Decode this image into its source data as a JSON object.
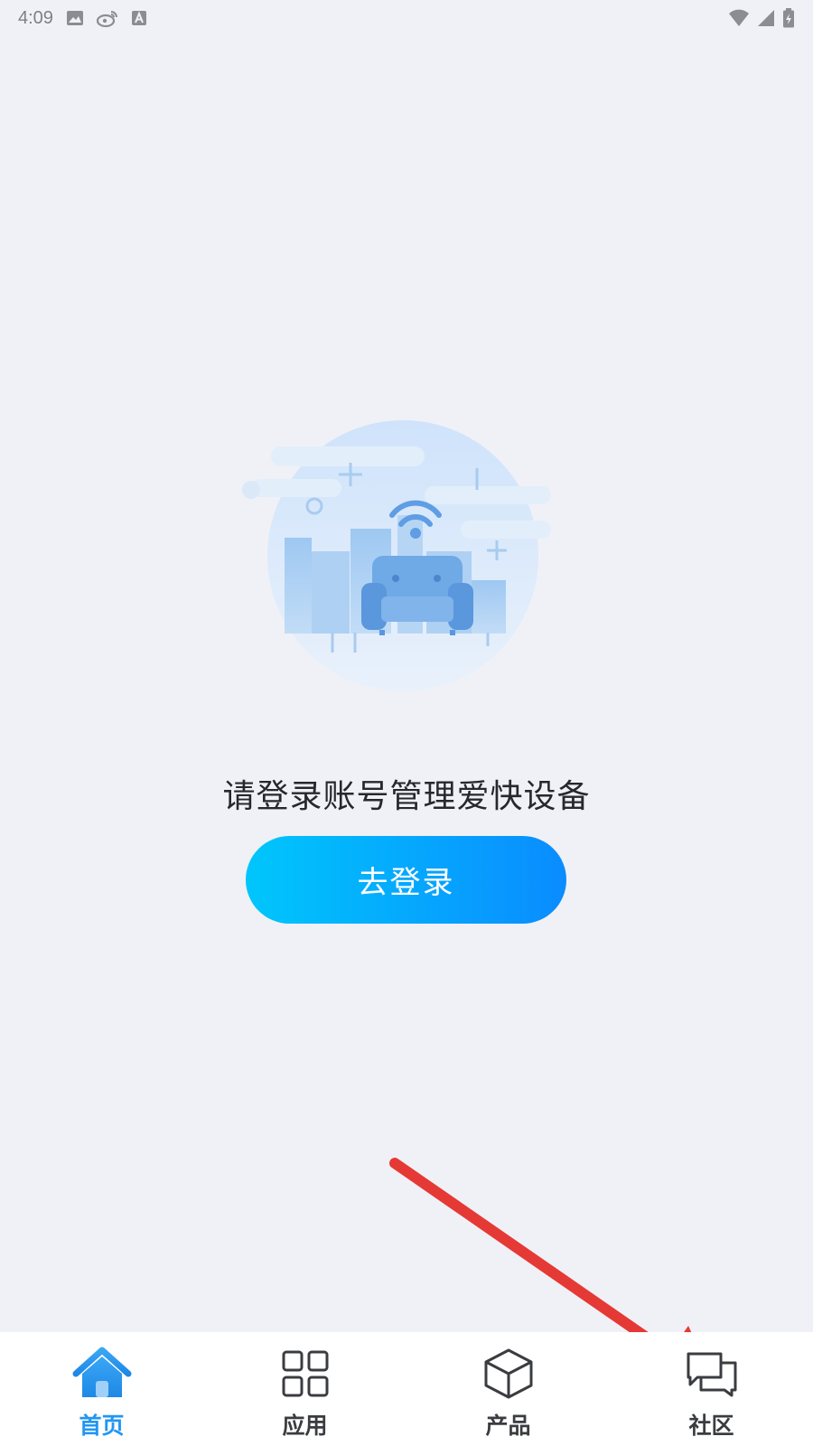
{
  "status_bar": {
    "time": "4:09",
    "left_icons": [
      "image-icon",
      "weibo-icon",
      "a-notification-icon"
    ],
    "right_icons": [
      "wifi-icon",
      "signal-icon",
      "battery-icon"
    ]
  },
  "main": {
    "prompt": "请登录账号管理爱快设备",
    "login_button_label": "去登录",
    "illustration": "smart-home-sofa-wifi-illustration"
  },
  "bottom_nav": {
    "items": [
      {
        "label": "首页",
        "icon": "home-icon",
        "active": true
      },
      {
        "label": "应用",
        "icon": "grid-icon",
        "active": false
      },
      {
        "label": "产品",
        "icon": "cube-icon",
        "active": false
      },
      {
        "label": "社区",
        "icon": "chat-icon",
        "active": false
      }
    ]
  },
  "colors": {
    "background": "#f0f1f6",
    "accent": "#2196f3",
    "button_gradient_start": "#00c6fb",
    "button_gradient_end": "#0a8cff",
    "annotation_arrow": "#e53935"
  }
}
